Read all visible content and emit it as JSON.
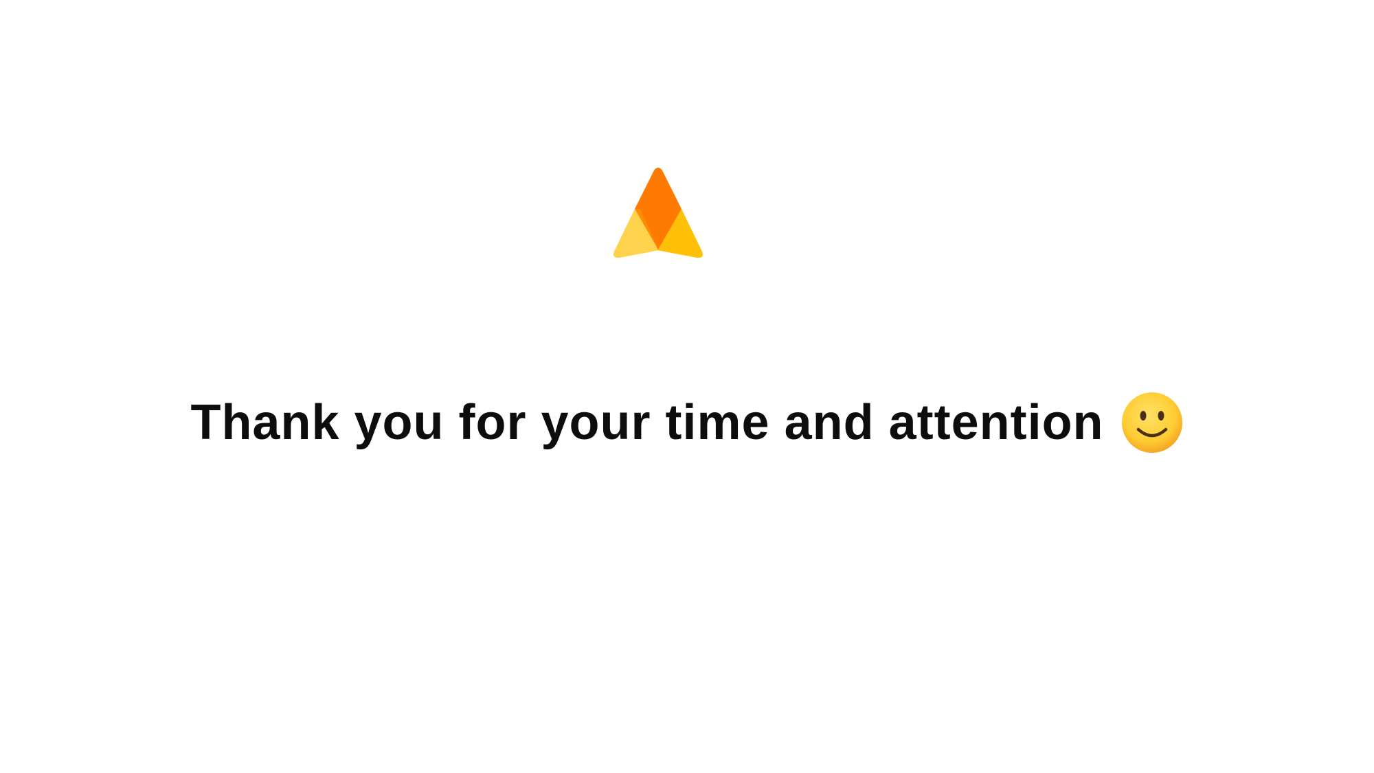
{
  "slide": {
    "message": "Thank you for your time and attention",
    "emoji_icon": "slightly-smiling-face-icon",
    "logo_icon": "triangle-logo-icon"
  },
  "colors": {
    "background": "#ffffff",
    "text": "#0d0d0d",
    "logo_top": "#ff7a00",
    "logo_left": "#ffd24d",
    "logo_right": "#ffc107",
    "emoji_face": "#ffcc33"
  }
}
